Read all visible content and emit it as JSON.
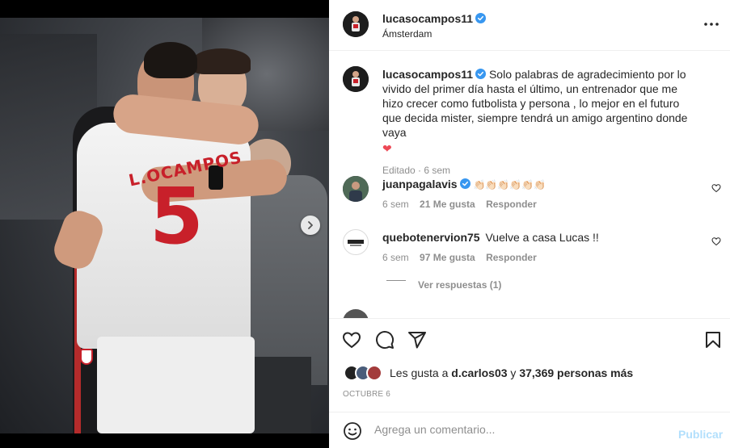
{
  "post": {
    "username": "lucasocampos11",
    "location": "Ámsterdam",
    "caption": "Solo palabras de agradecimiento por lo vivido del primer día hasta el último, un entrenador que me hizo crecer como futbolista y persona , lo mejor en el futuro que decida mister, siempre tendrá un amigo argentino donde vaya",
    "caption_emoji": "❤",
    "caption_meta": "Editado · 6 sem",
    "jersey_text": "L.OCAMPOS",
    "jersey_number": "5"
  },
  "comments": [
    {
      "username": "juanpagalavis",
      "text": "👏🏻👏🏻👏🏻👏🏻👏🏻👏🏻",
      "time": "6 sem",
      "likes": "21 Me gusta",
      "reply": "Responder"
    },
    {
      "username": "quebotenervion75",
      "text": "Vuelve a casa Lucas !!",
      "time": "6 sem",
      "likes": "97 Me gusta",
      "reply": "Responder",
      "view_replies": "Ver respuestas (1)"
    }
  ],
  "likes": {
    "prefix": "Les gusta a ",
    "user": "d.carlos03",
    "middle": " y ",
    "count": "37,369 personas más"
  },
  "date": "OCTUBRE 6",
  "add_comment": {
    "placeholder": "Agrega un comentario...",
    "post_label": "Publicar"
  },
  "colors": {
    "verified": "#3897f0",
    "heart": "#ed4956",
    "post_button_disabled": "#b2dffc",
    "secondary_text": "#8e8e8e"
  },
  "icons": {
    "like": "heart-outline-icon",
    "comment": "speech-bubble-icon",
    "share": "paper-plane-icon",
    "save": "bookmark-icon",
    "more": "ellipsis-icon",
    "emoji": "smiley-icon",
    "next": "chevron-right-icon"
  }
}
